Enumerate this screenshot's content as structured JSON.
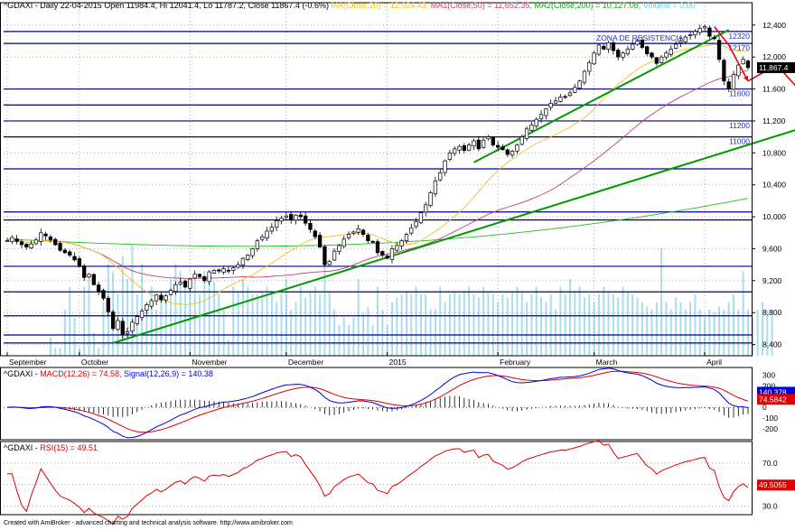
{
  "header": {
    "main_prefix": "^GDAXI - Daily 22-04-2015 Open 11984.4, Hi 12041.4, Lo 11787.2, Close 11867.4 (-0.6%)",
    "ma20_text": "MA(Close,20) = 12,024.43,",
    "ma50_text": "MA1(Close,50) = 11,652.35,",
    "ma200_text": "MA2(Close,200) = 10,127.08,",
    "volume_text": "Volume = 0.00",
    "macd_prefix": "^GDAXI - ",
    "macd_text": "MACD(12,26) = 74.58,",
    "signal_text": "Signal(12,26,9) = 140.38",
    "rsi_prefix": "^GDAXI - ",
    "rsi_text": "RSI(15) = 49.51"
  },
  "footer": "Created with AmiBroker - advanced charting and technical analysis software. http://www.amibroker.com",
  "colors": {
    "ma20": "#f0c020",
    "ma50": "#c04070",
    "ma200": "#20c020",
    "volume": "#aaddee",
    "trend": "#009900",
    "hline": "#000080",
    "arrow": "#ee0000",
    "macd": "#0000dd",
    "signal": "#dd0000",
    "rsi": "#dd0000",
    "price_tag": "#000000"
  },
  "chart_data": [
    {
      "type": "candlestick",
      "title": "^GDAXI - Daily 22-04-2015",
      "price_axis": {
        "ticks": [
          8400,
          8800,
          9200,
          9600,
          10000,
          10400,
          10800,
          11200,
          11600,
          12000,
          12400
        ]
      },
      "price_axis_labels": [
        "8,400",
        "8,800",
        "9,200",
        "9,600",
        "10,000",
        "10,400",
        "10,800",
        "11,200",
        "11,600",
        "12,000",
        "12,400"
      ],
      "ylim": [
        8260,
        12680
      ],
      "months": [
        {
          "label": "September",
          "day": 0
        },
        {
          "label": "October",
          "day": 15
        },
        {
          "label": "November",
          "day": 38
        },
        {
          "label": "December",
          "day": 58
        },
        {
          "label": "2015",
          "day": 79
        },
        {
          "label": "February",
          "day": 102
        },
        {
          "label": "March",
          "day": 122
        },
        {
          "label": "April",
          "day": 145
        }
      ],
      "last_close_label": "11,867.4",
      "closes": [
        9700,
        9740,
        9690,
        9650,
        9620,
        9660,
        9710,
        9800,
        9760,
        9710,
        9650,
        9580,
        9550,
        9520,
        9460,
        9380,
        9240,
        9280,
        9150,
        9060,
        8980,
        8810,
        8600,
        8700,
        8520,
        8560,
        8680,
        8750,
        8820,
        8900,
        8950,
        9020,
        8960,
        9010,
        9080,
        9150,
        9180,
        9120,
        9220,
        9280,
        9250,
        9200,
        9310,
        9330,
        9320,
        9350,
        9320,
        9360,
        9400,
        9480,
        9520,
        9600,
        9700,
        9750,
        9820,
        9870,
        9950,
        9980,
        10010,
        9960,
        10020,
        10000,
        9920,
        9840,
        9750,
        9620,
        9400,
        9440,
        9570,
        9640,
        9720,
        9780,
        9810,
        9850,
        9780,
        9700,
        9680,
        9550,
        9520,
        9480,
        9600,
        9640,
        9700,
        9780,
        9860,
        9940,
        10050,
        10150,
        10300,
        10450,
        10550,
        10700,
        10800,
        10850,
        10880,
        10830,
        10900,
        10950,
        10850,
        10960,
        11000,
        10900,
        10870,
        10840,
        10780,
        10820,
        10900,
        11000,
        11100,
        11150,
        11220,
        11280,
        11350,
        11420,
        11450,
        11500,
        11500,
        11550,
        11620,
        11700,
        11820,
        11930,
        12050,
        12150,
        12100,
        12180,
        12080,
        12000,
        12050,
        12100,
        12160,
        12200,
        12120,
        12040,
        12000,
        11920,
        12000,
        12050,
        12100,
        12160,
        12200,
        12250,
        12280,
        12320,
        12360,
        12380,
        12260,
        12230,
        11970,
        11700,
        11600,
        11780,
        11900,
        11970,
        11867
      ],
      "volume": [
        0,
        0,
        0,
        0,
        0,
        0,
        0,
        0,
        0,
        0.12,
        0.05,
        0.05,
        0.3,
        0.45,
        0.25,
        0.05,
        0.45,
        0.5,
        0.15,
        0.05,
        0.35,
        0.6,
        0.55,
        0.4,
        0.65,
        0.5,
        0.72,
        0.4,
        0.6,
        0.35,
        0.45,
        0.3,
        0.4,
        0.42,
        0.5,
        0.6,
        0.55,
        0.5,
        0.45,
        0.5,
        0.4,
        0.55,
        0.5,
        0.48,
        0.4,
        0.3,
        0.1,
        0.45,
        0.42,
        0.5,
        0.45,
        0.4,
        0.4,
        0.42,
        0.45,
        0.4,
        0.35,
        0.4,
        0.5,
        0.3,
        0.35,
        0.45,
        0.38,
        0.42,
        0.45,
        0.4,
        0.65,
        0.42,
        0.3,
        0.2,
        0.25,
        0.2,
        0.25,
        0.5,
        0.28,
        0.32,
        0.2,
        0.45,
        0.3,
        0.2,
        0.35,
        0.38,
        0.4,
        0.42,
        0.4,
        0.45,
        0.4,
        0.4,
        0.3,
        0.3,
        0.45,
        0.35,
        0.4,
        0.42,
        0.4,
        0.42,
        0.45,
        0.4,
        0.38,
        0.45,
        0.42,
        0.4,
        0.35,
        0.4,
        0.38,
        0.42,
        0.45,
        0.42,
        0.35,
        0.4,
        0.45,
        0.38,
        0.35,
        0.4,
        0.3,
        0.45,
        0.4,
        0.5,
        0.42,
        0.45,
        0.38,
        0.4,
        0.35,
        0.4,
        0.45,
        0.42,
        0.4,
        0.38,
        0.45,
        0.42,
        0.4,
        0.38,
        0.35,
        0.32,
        0.3,
        0.35,
        0.7,
        0.35,
        0.3,
        0.38,
        0.35,
        0.3,
        0.35,
        0.4,
        0.3,
        0.25,
        0.3,
        0.28,
        0.32,
        0.3,
        0.35,
        0.4,
        0.3,
        0.55,
        0.3,
        0.25,
        0.3,
        0.35,
        0.3,
        0.3
      ]
    },
    {
      "type": "line",
      "series": [
        {
          "name": "MA(Close,20)",
          "ref": "ma20"
        },
        {
          "name": "MA1(Close,50)",
          "ref": "ma50"
        },
        {
          "name": "MA2(Close,200)",
          "ref": "ma200"
        }
      ]
    },
    {
      "type": "annotations",
      "levels": [
        {
          "value": 12320,
          "label": "12320"
        },
        {
          "value": 12170,
          "label": "12170"
        },
        {
          "value": 11600,
          "label": "11600"
        },
        {
          "value": 11400,
          "label": ""
        },
        {
          "value": 11200,
          "label": "11200"
        },
        {
          "value": 11000,
          "label": "11000"
        },
        {
          "value": 10600,
          "label": ""
        },
        {
          "value": 10060,
          "label": ""
        },
        {
          "value": 9960,
          "label": ""
        },
        {
          "value": 9380,
          "label": ""
        },
        {
          "value": 9060,
          "label": ""
        },
        {
          "value": 8760,
          "label": ""
        },
        {
          "value": 8520,
          "label": ""
        },
        {
          "value": 8420,
          "label": ""
        }
      ],
      "zone_label": "ZONA DE RESISTENCIA",
      "trendlines": [
        {
          "from": {
            "day": 22,
            "price": 8420
          },
          "to": {
            "day": 171,
            "price": 11220
          }
        },
        {
          "from": {
            "day": 97,
            "price": 10680
          },
          "to": {
            "day": 150,
            "price": 12340
          }
        }
      ],
      "arrows": [
        {
          "points": [
            [
              147,
              12380
            ],
            [
              150,
              12150
            ],
            [
              154,
              11700
            ]
          ]
        },
        {
          "points": [
            [
              154,
              11700
            ],
            [
              160,
              11900
            ],
            [
              170,
              11230
            ]
          ]
        }
      ]
    },
    {
      "type": "line",
      "title": "MACD(12,26)",
      "ylim": [
        -300,
        370
      ],
      "ticks": [
        -200,
        -100,
        0,
        100,
        200,
        300
      ],
      "last_macd_label": "74.5842",
      "last_signal_label": "140.378",
      "series": [
        {
          "name": "MACD(12,26)",
          "ref": "macd"
        },
        {
          "name": "Signal(12,26,9)",
          "ref": "signal"
        }
      ]
    },
    {
      "type": "line",
      "title": "RSI(15)",
      "ylim": [
        22,
        90
      ],
      "ticks": [
        30,
        50,
        70
      ],
      "tick_labels": [
        "30.0",
        "50.0",
        "70.0"
      ],
      "last_label": "49.5055",
      "series": [
        {
          "name": "RSI(15)",
          "ref": "rsi"
        }
      ]
    }
  ]
}
